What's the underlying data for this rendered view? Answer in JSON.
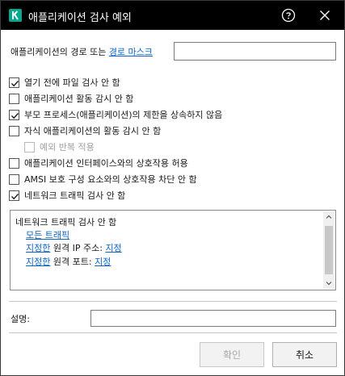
{
  "window": {
    "title": "애플리케이션 검사 예외",
    "logo_letter": "K",
    "colors": {
      "titlebar": "#000000",
      "logo": "#00a88e",
      "link": "#0a64c8"
    },
    "icons": {
      "help": "question-circle-icon",
      "close": "close-x-icon"
    }
  },
  "path": {
    "label": "애플리케이션의 경로 또는 ",
    "link": "경로 마스크",
    "value": ""
  },
  "options": [
    {
      "label": "열기 전에 파일 검사 안 함",
      "checked": true,
      "enabled": true
    },
    {
      "label": "애플리케이션 활동 감시 안 함",
      "checked": false,
      "enabled": true
    },
    {
      "label": "부모 프로세스(애플리케이션)의 제한을 상속하지 않음",
      "checked": true,
      "enabled": true
    },
    {
      "label": "자식 애플리케이션의 활동 감시 안 함",
      "checked": false,
      "enabled": true
    },
    {
      "label": "예외 반복 적용",
      "checked": false,
      "enabled": false
    },
    {
      "label": "애플리케이션 인터페이스와의 상호작용 허용",
      "checked": false,
      "enabled": true
    },
    {
      "label": "AMSI 보호 구성 요소와의 상호작용 차단 안 함",
      "checked": false,
      "enabled": true
    },
    {
      "label": "네트워크 트래픽 검사 안 함",
      "checked": true,
      "enabled": true
    }
  ],
  "detail": {
    "title": "네트워크 트래픽 검사 안 함",
    "all_traffic": "모든 트래픽",
    "ip_prefix": "지정한",
    "ip_text": " 원격 IP 주소: ",
    "ip_value": "지정",
    "port_prefix": "지정한",
    "port_text": " 원격 포트: ",
    "port_value": "지정"
  },
  "description": {
    "label": "설명:",
    "value": ""
  },
  "buttons": {
    "ok": "확인",
    "cancel": "취소"
  }
}
